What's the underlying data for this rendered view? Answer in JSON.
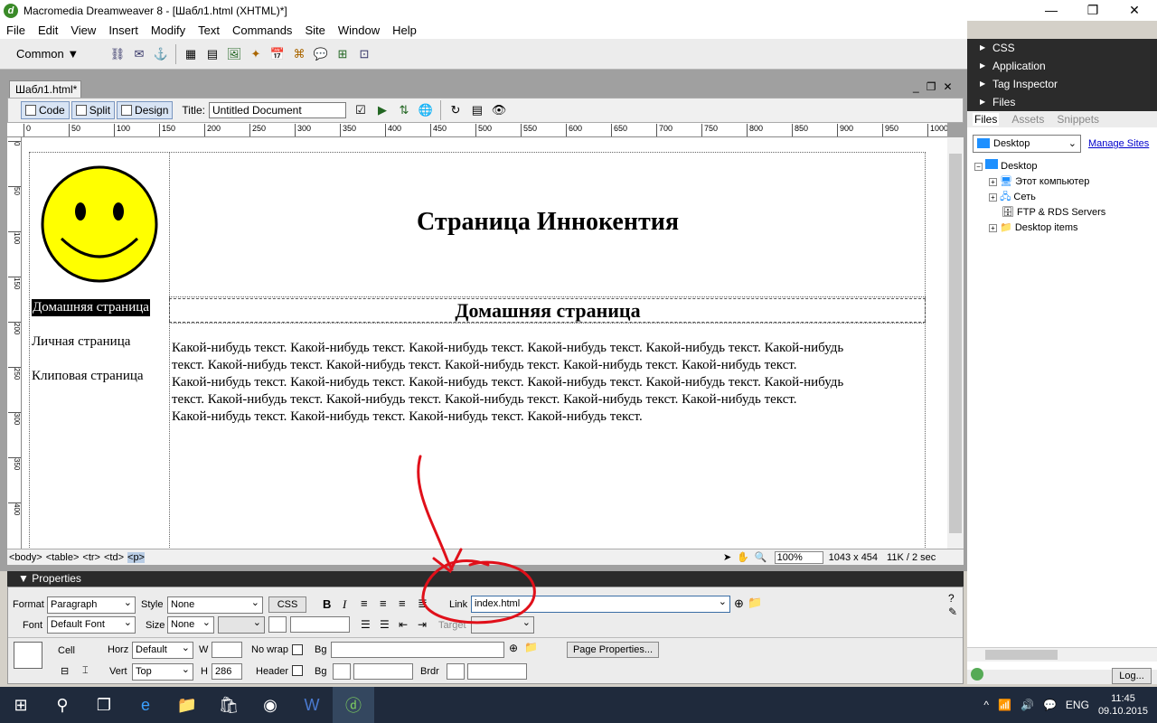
{
  "window": {
    "title": "Macromedia Dreamweaver 8 - [Шабл1.html (XHTML)*]",
    "app_icon": "d",
    "minimize": "—",
    "maximize": "❐",
    "close": "✕"
  },
  "menu": [
    "File",
    "Edit",
    "View",
    "Insert",
    "Modify",
    "Text",
    "Commands",
    "Site",
    "Window",
    "Help"
  ],
  "insert_bar": {
    "category": "Common"
  },
  "document": {
    "tab": "Шабл1.html*",
    "title_label": "Title:",
    "title_value": "Untitled Document",
    "views": [
      "Code",
      "Split",
      "Design"
    ]
  },
  "ruler": {
    "h_ticks": [
      "0",
      "50",
      "100",
      "150",
      "200",
      "250",
      "300",
      "350",
      "400",
      "450",
      "500",
      "550",
      "600",
      "650",
      "700",
      "750",
      "800",
      "850",
      "900",
      "950",
      "1000"
    ],
    "v_ticks": [
      "0",
      "50",
      "100",
      "150",
      "200",
      "250",
      "300",
      "350",
      "400"
    ]
  },
  "page": {
    "heading": "Страница Иннокентия",
    "nav": [
      "Домашняя страница",
      "Личная страница",
      "Клиповая страница"
    ],
    "subheading": "Домашняя страница",
    "body_lines": [
      "Какой-нибудь текст. Какой-нибудь текст. Какой-нибудь текст. Какой-нибудь текст. Какой-нибудь текст. Какой-нибудь",
      "текст. Какой-нибудь текст. Какой-нибудь текст. Какой-нибудь текст. Какой-нибудь текст. Какой-нибудь текст.",
      "Какой-нибудь текст. Какой-нибудь текст. Какой-нибудь текст. Какой-нибудь текст. Какой-нибудь текст. Какой-нибудь",
      "текст. Какой-нибудь текст. Какой-нибудь текст. Какой-нибудь текст. Какой-нибудь текст. Какой-нибудь текст.",
      "Какой-нибудь текст. Какой-нибудь текст. Какой-нибудь текст. Какой-нибудь текст."
    ]
  },
  "status": {
    "tags": [
      "<body>",
      "<table>",
      "<tr>",
      "<td>",
      "<p>"
    ],
    "zoom": "100%",
    "size": "1043 x 454",
    "download": "11K / 2 sec"
  },
  "properties": {
    "title": "Properties",
    "format_label": "Format",
    "format": "Paragraph",
    "style_label": "Style",
    "style": "None",
    "css_btn": "CSS",
    "bold": "B",
    "italic": "I",
    "link_label": "Link",
    "link": "index.html",
    "font_label": "Font",
    "font": "Default Font",
    "size_label": "Size",
    "size": "None",
    "target_label": "Target",
    "cell_label": "Cell",
    "horz_label": "Horz",
    "horz": "Default",
    "w_label": "W",
    "nowrap_label": "No wrap",
    "bg_label": "Bg",
    "page_props": "Page Properties...",
    "vert_label": "Vert",
    "vert": "Top",
    "h_label": "H",
    "h": "286",
    "header_label": "Header",
    "bg2_label": "Bg",
    "brdr_label": "Brdr"
  },
  "right_panel": {
    "groups": [
      "CSS",
      "Application",
      "Tag Inspector",
      "Files"
    ],
    "tabs": [
      "Files",
      "Assets",
      "Snippets"
    ],
    "site": "Desktop",
    "manage": "Manage Sites",
    "tree_root": "Desktop",
    "tree": [
      "Этот компьютер",
      "Сеть",
      "FTP & RDS Servers",
      "Desktop items"
    ],
    "log": "Log..."
  },
  "taskbar": {
    "lang": "ENG",
    "time": "11:45",
    "date": "09.10.2015"
  },
  "colors": {
    "smiley": "#ffff00",
    "annotation": "#e0101a",
    "accent": "#7a96c0"
  }
}
